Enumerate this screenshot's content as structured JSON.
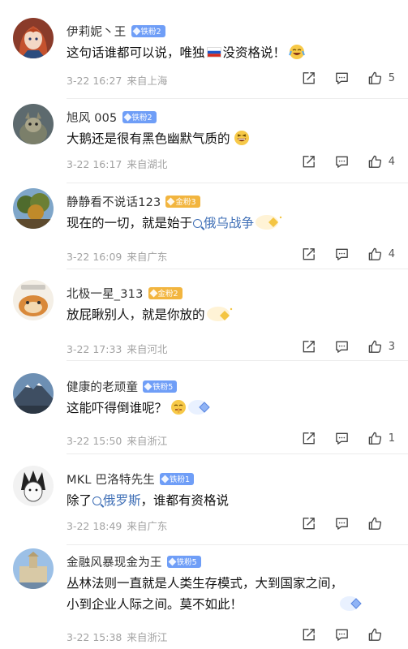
{
  "comments": [
    {
      "name": "伊莉妮丶王",
      "badge": "铁粉2",
      "badge_color": "blue",
      "text_a": "这句话谁都可以说，唯独",
      "text_b": "没资格说！",
      "date": "3-22 16:27",
      "location": "来自上海",
      "likes": "5",
      "avatar_icon": "anime-girl-avatar"
    },
    {
      "name": "旭风 005",
      "badge": "铁粉2",
      "badge_color": "blue",
      "text_a": "大鹅还是很有黑色幽默气质的",
      "date": "3-22 16:17",
      "location": "来自湖北",
      "likes": "4",
      "avatar_icon": "animal-avatar"
    },
    {
      "name": "静静看不说话123",
      "badge": "金粉3",
      "badge_color": "gold",
      "text_a": "现在的一切，就是始于",
      "topic": "俄乌战争",
      "date": "3-22 16:09",
      "location": "来自广东",
      "likes": "4",
      "avatar_icon": "tree-avatar"
    },
    {
      "name": "北极一星_313",
      "badge": "金粉2",
      "badge_color": "gold",
      "text_a": "放屁瞅别人，就是你放的",
      "date": "3-22 17:33",
      "location": "来自河北",
      "likes": "3",
      "avatar_icon": "cartoon-cat-avatar"
    },
    {
      "name": "健康的老顽童",
      "badge": "铁粉5",
      "badge_color": "blue",
      "text_a": "这能吓得倒谁呢？",
      "date": "3-22 15:50",
      "location": "来自浙江",
      "likes": "1",
      "avatar_icon": "mountain-avatar"
    },
    {
      "name": "MKL 巴洛特先生",
      "badge": "铁粉1",
      "badge_color": "blue",
      "text_a": "除了",
      "topic": "俄罗斯",
      "text_b": "，谁都有资格说",
      "date": "3-22 18:49",
      "location": "来自广东",
      "likes": "",
      "avatar_icon": "sketch-avatar"
    },
    {
      "name": "金融风暴现金为王",
      "badge": "铁粉5",
      "badge_color": "blue",
      "text_a": "丛林法则一直就是人类生存模式，大到国家之间，",
      "text_b": "小到企业人际之间。莫不如此！",
      "date": "3-22 15:38",
      "location": "来自浙江",
      "likes": "",
      "avatar_icon": "building-avatar"
    }
  ],
  "colors": {
    "blue_badge": "#6f9ef7",
    "gold_badge": "#f2b53f",
    "topic": "#3f6fb6"
  }
}
